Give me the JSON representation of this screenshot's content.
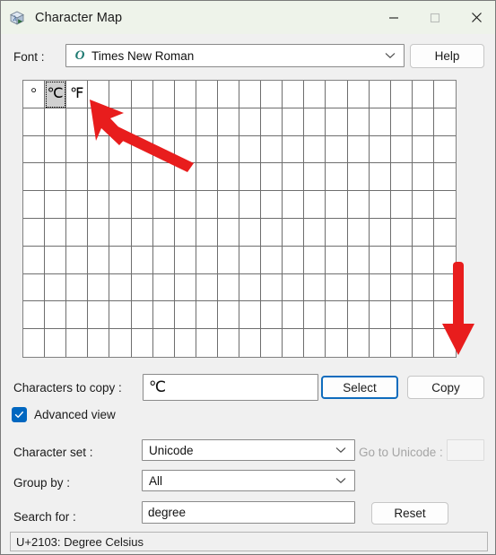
{
  "window": {
    "title": "Character Map",
    "app_icon": "character-map-icon",
    "minimize_label": "Minimize",
    "maximize_label": "Maximize",
    "close_label": "Close"
  },
  "font_row": {
    "label": "Font :",
    "font_icon": "O",
    "selected_font": "Times New Roman",
    "help_label": "Help"
  },
  "grid": {
    "columns": 20,
    "rows": 10,
    "selected_index": 1,
    "characters": [
      "°",
      "℃",
      "℉"
    ]
  },
  "copy_row": {
    "label": "Characters to copy :",
    "value": "℃",
    "placeholder": "",
    "select_label": "Select",
    "copy_label": "Copy"
  },
  "advanced": {
    "label": "Advanced view",
    "checked": true
  },
  "charset_row": {
    "label": "Character set :",
    "value": "Unicode",
    "goto_label": "Go to Unicode :",
    "goto_value": "",
    "goto_disabled": true
  },
  "groupby_row": {
    "label": "Group by :",
    "value": "All"
  },
  "search_row": {
    "label": "Search for :",
    "value": "degree",
    "reset_label": "Reset"
  },
  "status": {
    "text": "U+2103: Degree Celsius"
  },
  "colors": {
    "titlebar": "#eef3ea",
    "body": "#f0f0f0",
    "accent": "#0067c0",
    "focus_ring": "#0f6cbd",
    "annotation": "#e81d1d"
  },
  "annotations": {
    "arrow_to_grid": "points-at-selected-character-cell",
    "arrow_to_copy": "points-at-copy-button"
  }
}
